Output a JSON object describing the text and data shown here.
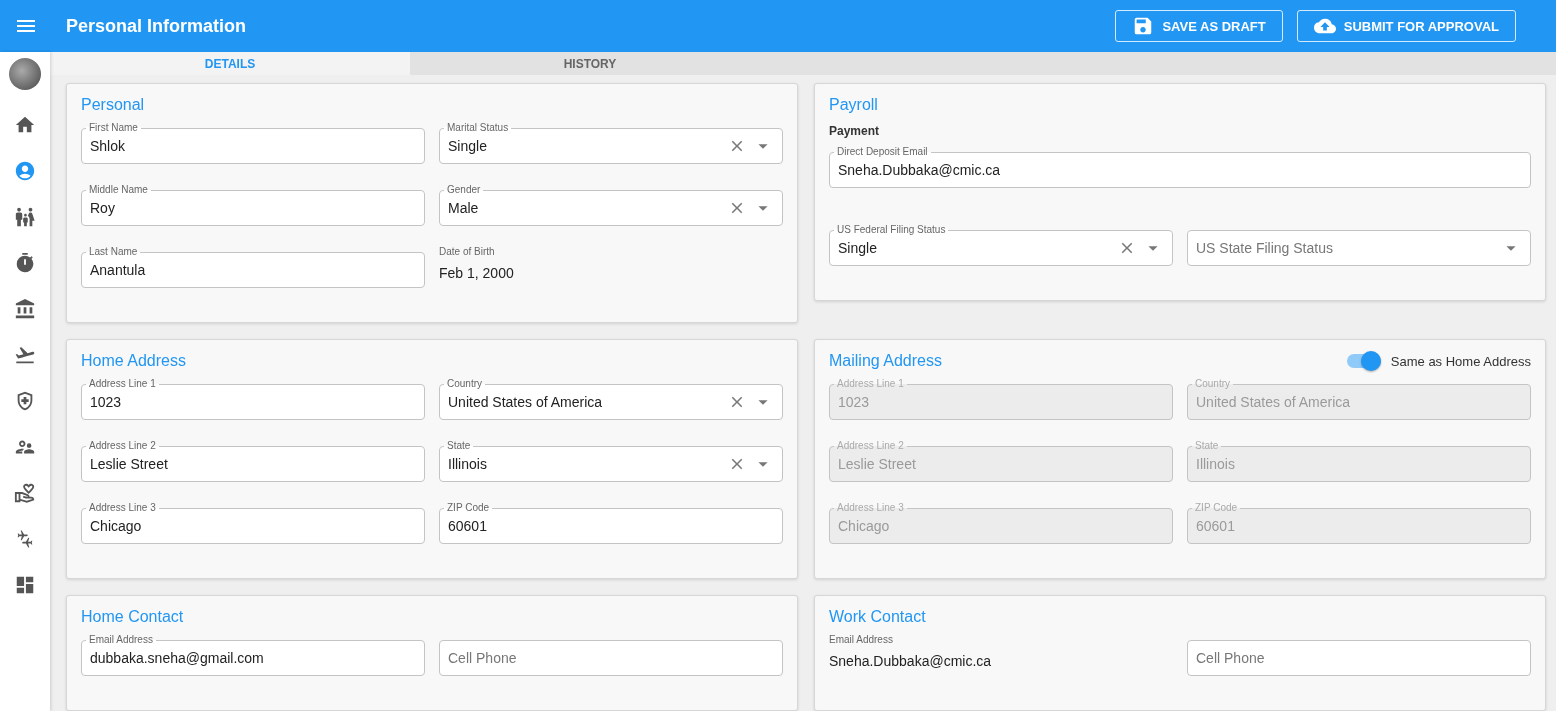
{
  "header": {
    "title": "Personal Information",
    "buttons": [
      {
        "label": "SAVE AS DRAFT",
        "kind": "save"
      },
      {
        "label": "SUBMIT FOR APPROVAL",
        "kind": "upload"
      }
    ]
  },
  "sidebar": {
    "items": [
      {
        "selected": false
      },
      {
        "selected": true
      },
      {
        "selected": false
      },
      {
        "selected": false
      },
      {
        "selected": false
      },
      {
        "selected": false
      },
      {
        "selected": false
      },
      {
        "selected": false
      },
      {
        "selected": false
      },
      {
        "selected": false
      },
      {
        "selected": false
      }
    ]
  },
  "tabs": [
    {
      "label": "DETAILS",
      "selected": true
    },
    {
      "label": "HISTORY",
      "selected": false
    }
  ],
  "card_rows": [
    [
      {
        "title": "Personal",
        "fields": [
          {
            "label": "First Name",
            "value": "Shlok",
            "kind": "text"
          },
          {
            "label": "Marital Status",
            "value": "Single",
            "kind": "select",
            "clearable": true
          },
          {
            "label": "Middle Name",
            "value": "Roy",
            "kind": "text"
          },
          {
            "label": "Gender",
            "value": "Male",
            "kind": "select",
            "clearable": true
          },
          {
            "label": "Last Name",
            "value": "Anantula",
            "kind": "text"
          },
          {
            "label": "Date of Birth",
            "value": "Feb 1, 2000",
            "kind": "plain"
          }
        ]
      },
      {
        "title": "Payroll",
        "subtitle": "Payment",
        "fields": [
          {
            "label": "Direct Deposit Email",
            "value": "Sneha.Dubbaka@cmic.ca",
            "kind": "text",
            "wide": true
          },
          {
            "label": "US Federal Filing Status",
            "value": "Single",
            "kind": "select",
            "clearable": true
          },
          {
            "placeholder": "US State Filing Status",
            "kind": "select",
            "clearable": false
          }
        ]
      }
    ],
    [
      {
        "title": "Home Address",
        "fields": [
          {
            "label": "Address Line 1",
            "value": "1023",
            "kind": "text"
          },
          {
            "label": "Country",
            "value": "United States of America",
            "kind": "select",
            "clearable": true
          },
          {
            "label": "Address Line 2",
            "value": "Leslie Street",
            "kind": "text"
          },
          {
            "label": "State",
            "value": "Illinois",
            "kind": "select",
            "clearable": true
          },
          {
            "label": "Address Line 3",
            "value": "Chicago",
            "kind": "text"
          },
          {
            "label": "ZIP Code",
            "value": "60601",
            "kind": "text"
          }
        ]
      },
      {
        "title": "Mailing Address",
        "disabled": true,
        "toggle": {
          "label": "Same as Home Address",
          "on": true
        },
        "fields": [
          {
            "label": "Address Line 1",
            "value": "1023",
            "kind": "text"
          },
          {
            "label": "Country",
            "value": "United States of America",
            "kind": "text"
          },
          {
            "label": "Address Line 2",
            "value": "Leslie Street",
            "kind": "text"
          },
          {
            "label": "State",
            "value": "Illinois",
            "kind": "text"
          },
          {
            "label": "Address Line 3",
            "value": "Chicago",
            "kind": "text"
          },
          {
            "label": "ZIP Code",
            "value": "60601",
            "kind": "text"
          }
        ]
      }
    ],
    [
      {
        "title": "Home Contact",
        "fields": [
          {
            "label": "Email Address",
            "value": "dubbaka.sneha@gmail.com",
            "kind": "text"
          },
          {
            "placeholder": "Cell Phone",
            "kind": "text"
          }
        ]
      },
      {
        "title": "Work Contact",
        "fields": [
          {
            "label": "Email Address",
            "value": "Sneha.Dubbaka@cmic.ca",
            "kind": "plain"
          },
          {
            "placeholder": "Cell Phone",
            "kind": "text"
          }
        ]
      }
    ]
  ]
}
